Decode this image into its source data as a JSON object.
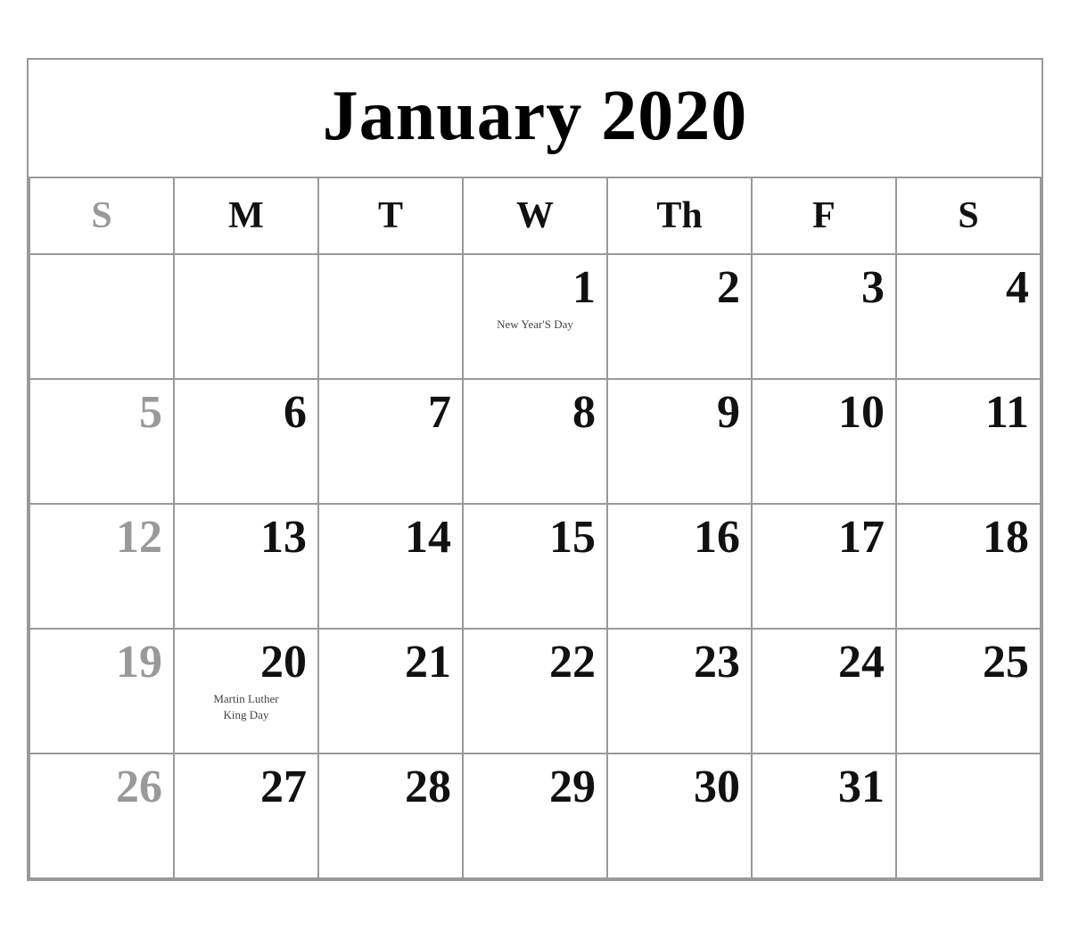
{
  "title": "January 2020",
  "headers": [
    {
      "label": "S",
      "bold": false
    },
    {
      "label": "M",
      "bold": true
    },
    {
      "label": "T",
      "bold": true
    },
    {
      "label": "W",
      "bold": true
    },
    {
      "label": "Th",
      "bold": true
    },
    {
      "label": "F",
      "bold": true
    },
    {
      "label": "S",
      "bold": true
    }
  ],
  "weeks": [
    [
      {
        "day": "",
        "sunday": true
      },
      {
        "day": "",
        "sunday": false
      },
      {
        "day": "",
        "sunday": false
      },
      {
        "day": "1",
        "sunday": false,
        "note": "New Year'S Day"
      },
      {
        "day": "2",
        "sunday": false
      },
      {
        "day": "3",
        "sunday": false
      },
      {
        "day": "4",
        "sunday": false
      }
    ],
    [
      {
        "day": "5",
        "sunday": true
      },
      {
        "day": "6",
        "sunday": false
      },
      {
        "day": "7",
        "sunday": false
      },
      {
        "day": "8",
        "sunday": false
      },
      {
        "day": "9",
        "sunday": false
      },
      {
        "day": "10",
        "sunday": false
      },
      {
        "day": "11",
        "sunday": false
      }
    ],
    [
      {
        "day": "12",
        "sunday": true
      },
      {
        "day": "13",
        "sunday": false
      },
      {
        "day": "14",
        "sunday": false
      },
      {
        "day": "15",
        "sunday": false
      },
      {
        "day": "16",
        "sunday": false
      },
      {
        "day": "17",
        "sunday": false
      },
      {
        "day": "18",
        "sunday": false
      }
    ],
    [
      {
        "day": "19",
        "sunday": true
      },
      {
        "day": "20",
        "sunday": false,
        "note": "Martin Luther\nKing Day"
      },
      {
        "day": "21",
        "sunday": false
      },
      {
        "day": "22",
        "sunday": false
      },
      {
        "day": "23",
        "sunday": false
      },
      {
        "day": "24",
        "sunday": false
      },
      {
        "day": "25",
        "sunday": false
      }
    ],
    [
      {
        "day": "26",
        "sunday": true
      },
      {
        "day": "27",
        "sunday": false
      },
      {
        "day": "28",
        "sunday": false
      },
      {
        "day": "29",
        "sunday": false
      },
      {
        "day": "30",
        "sunday": false
      },
      {
        "day": "31",
        "sunday": false
      },
      {
        "day": "",
        "sunday": false
      }
    ]
  ]
}
